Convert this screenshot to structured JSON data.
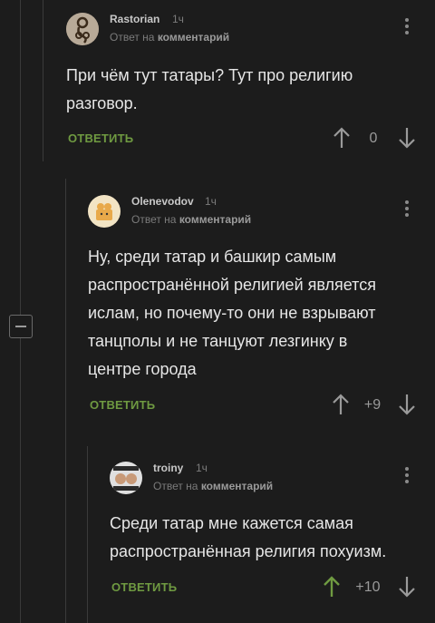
{
  "comments": [
    {
      "author": "Rastorian",
      "time": "1ч",
      "reply_prefix": "Ответ на",
      "reply_link": "комментарий",
      "text_lines": [
        "При чём тут татары? Тут про религию",
        "разговор."
      ],
      "reply_label": "ОТВЕТИТЬ",
      "rating": "0"
    },
    {
      "author": "Olenevodov",
      "time": "1ч",
      "reply_prefix": "Ответ на",
      "reply_link": "комментарий",
      "text_lines": [
        "Ну, среди татар и башкир самым",
        "распространённой религией является",
        "ислам, но почему-то они не взрывают",
        "танцполы и не танцуют лезгинку в",
        "центре города"
      ],
      "reply_label": "ОТВЕТИТЬ",
      "rating": "+9"
    },
    {
      "author": "troiny",
      "time": "1ч",
      "reply_prefix": "Ответ на",
      "reply_link": "комментарий",
      "text_lines": [
        "Среди татар мне кажется самая",
        "распространённая религия похуизм."
      ],
      "reply_label": "ОТВЕТИТЬ",
      "rating": "+10"
    }
  ],
  "colors": {
    "background": "#1c1c1c",
    "reply_green": "#6f9a41",
    "upvote_active": "#6f9a41",
    "arrow_gray": "#9a9a9a"
  },
  "icons": [
    "kebab-menu-icon",
    "upvote-arrow-icon",
    "downvote-arrow-icon",
    "collapse-minus-icon"
  ]
}
